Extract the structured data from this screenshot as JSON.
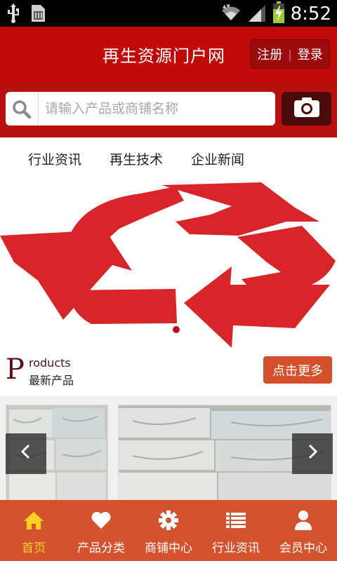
{
  "status_bar": {
    "time": "8:52",
    "icons": [
      "usb-icon",
      "sd-card-icon",
      "wifi-icon",
      "signal-icon",
      "battery-charging-icon"
    ]
  },
  "header": {
    "title": "再生资源门户网",
    "register_label": "注册",
    "login_label": "登录"
  },
  "search": {
    "placeholder": "请输入产品或商铺名称",
    "value": "",
    "icon": "search-icon",
    "camera_icon": "camera-icon"
  },
  "category_nav": {
    "items": [
      {
        "label": "行业资讯"
      },
      {
        "label": "再生技术"
      },
      {
        "label": "企业新闻"
      }
    ]
  },
  "banner": {
    "image": "recycle-arrows-icon",
    "color": "#d8252a",
    "slide_count": 1,
    "active_slide": 1
  },
  "products": {
    "letter": "P",
    "rest": "roducts",
    "title_cn": "最新产品",
    "more_label": "点击更多",
    "prev_icon": "chevron-left-icon",
    "next_icon": "chevron-right-icon"
  },
  "tabbar": {
    "items": [
      {
        "label": "首页",
        "icon": "home-icon",
        "active": true
      },
      {
        "label": "产品分类",
        "icon": "heart-icon",
        "active": false
      },
      {
        "label": "商铺中心",
        "icon": "gear-icon",
        "active": false
      },
      {
        "label": "行业资讯",
        "icon": "list-icon",
        "active": false
      },
      {
        "label": "会员中心",
        "icon": "user-icon",
        "active": false
      }
    ]
  },
  "colors": {
    "header_red": "#c10b0b",
    "search_band": "#b80f0f",
    "accent_orange": "#d4532e",
    "active_tab": "#ffd024"
  }
}
